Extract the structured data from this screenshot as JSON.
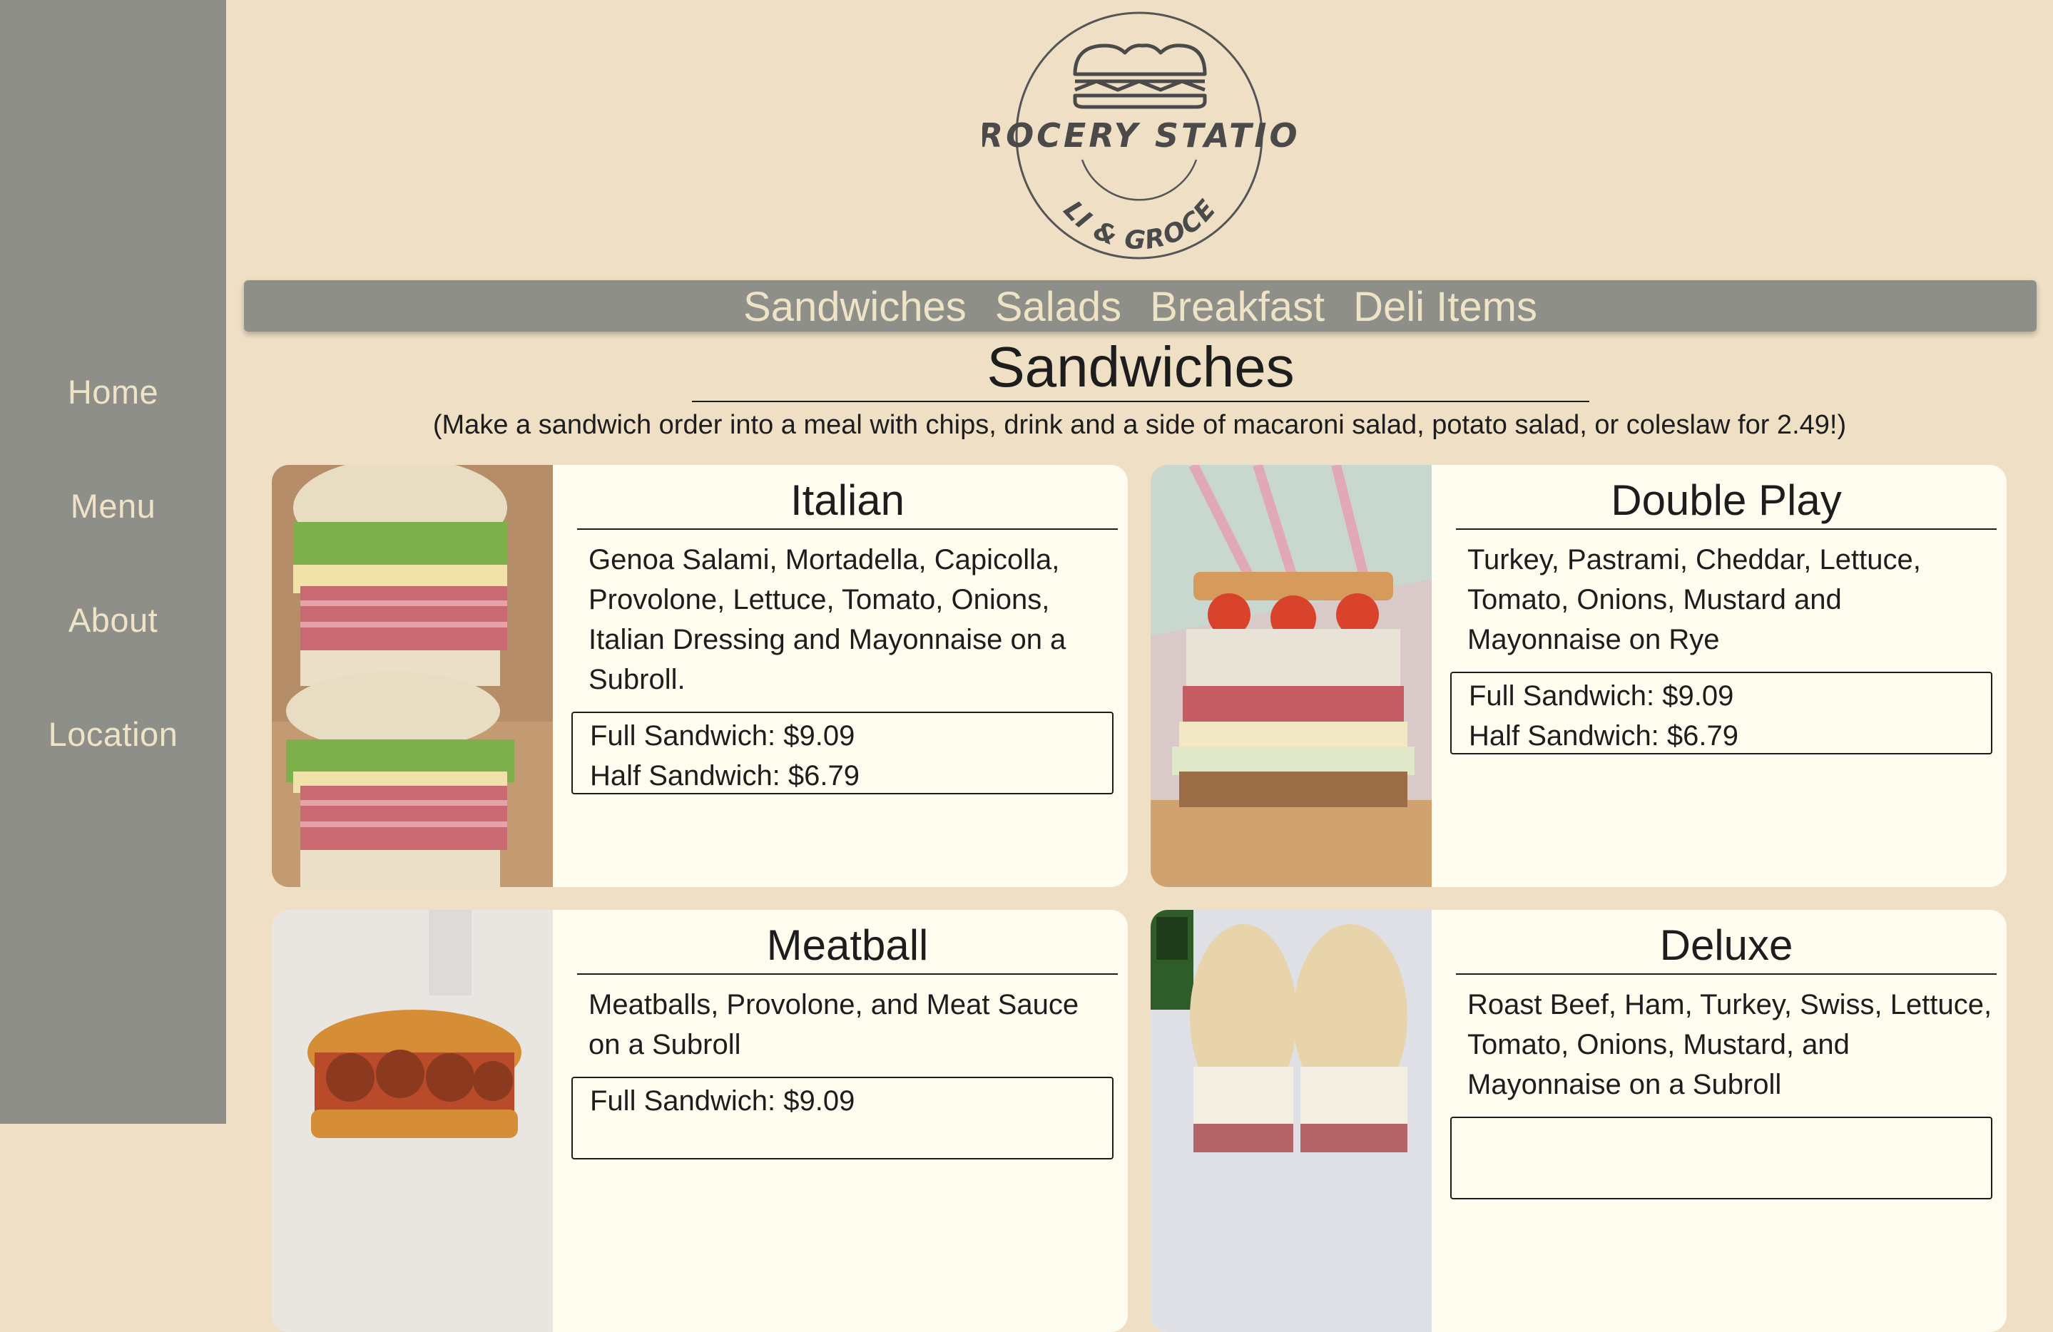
{
  "sidebar": {
    "items": [
      {
        "label": "Home"
      },
      {
        "label": "Menu"
      },
      {
        "label": "About"
      },
      {
        "label": "Location"
      }
    ]
  },
  "logo": {
    "title": "GROCERY STATION",
    "subtitle": "DELI & GROCERY",
    "icon": "sandwich-icon"
  },
  "topnav": {
    "items": [
      {
        "label": "Sandwiches"
      },
      {
        "label": "Salads"
      },
      {
        "label": "Breakfast"
      },
      {
        "label": "Deli Items"
      }
    ]
  },
  "section": {
    "title": "Sandwiches",
    "subtitle": "(Make a sandwich order into a meal with chips, drink and a side of macaroni salad, potato salad, or coleslaw for 2.49!)"
  },
  "cards": [
    {
      "name": "Italian",
      "description": "Genoa Salami, Mortadella, Capicolla, Provolone, Lettuce, Tomato, Onions, Italian Dressing and Mayonnaise on a Subroll.",
      "full_price": "Full Sandwich: $9.09",
      "half_price": "Half Sandwich: $6.79"
    },
    {
      "name": "Double Play",
      "description": "Turkey, Pastrami, Cheddar, Lettuce, Tomato, Onions, Mustard and Mayonnaise on Rye",
      "full_price": "Full Sandwich: $9.09",
      "half_price": "Half Sandwich: $6.79"
    },
    {
      "name": "Meatball",
      "description": "Meatballs, Provolone, and Meat Sauce on a Subroll",
      "full_price": "Full Sandwich: $9.09",
      "half_price": ""
    },
    {
      "name": "Deluxe",
      "description": "Roast Beef, Ham, Turkey, Swiss, Lettuce, Tomato, Onions, Mustard, and Mayonnaise on a Subroll",
      "full_price": "",
      "half_price": ""
    }
  ],
  "colors": {
    "background": "#eedfc5",
    "sidebar": "#8e8f89",
    "nav_text": "#efe3c6",
    "card": "#fefbef"
  }
}
